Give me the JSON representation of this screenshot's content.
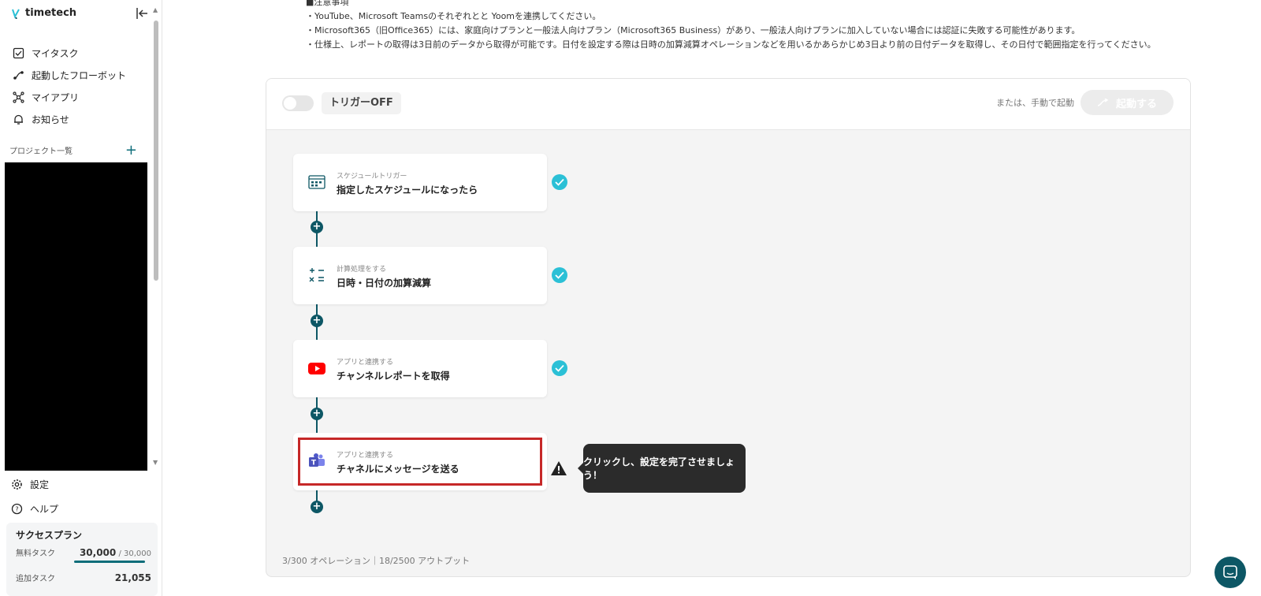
{
  "sidebar": {
    "brand": "timetech",
    "nav": [
      {
        "label": "マイタスク",
        "icon": "checkbox-icon"
      },
      {
        "label": "起動したフローボット",
        "icon": "flowbot-icon"
      },
      {
        "label": "マイアプリ",
        "icon": "apps-icon"
      },
      {
        "label": "お知らせ",
        "icon": "bell-icon"
      }
    ],
    "projects_heading": "プロジェクト一覧",
    "projects_add": "+",
    "bottom": [
      {
        "label": "設定",
        "icon": "gear-icon"
      },
      {
        "label": "ヘルプ",
        "icon": "help-icon"
      }
    ],
    "plan": {
      "title": "サクセスプラン",
      "free_label": "無料タスク",
      "free_used": "30,000",
      "free_total": "/ 30,000",
      "free_ratio": 1.0,
      "extra_label": "追加タスク",
      "extra_value": "21,055"
    }
  },
  "notes": {
    "heading": "■注意事項",
    "lines": [
      "・YouTube、Microsoft Teamsのそれぞれとと Yoomを連携してください。",
      "・Microsoft365（旧Office365）には、家庭向けプランと一般法人向けプラン（Microsoft365 Business）があり、一般法人向けプランに加入していない場合には認証に失敗する可能性があります。",
      "・仕様上、レポートの取得は3日前のデータから取得が可能です。日付を設定する際は日時の加算減算オペレーションなどを用いるかあらかじめ3日より前の日付データを取得し、その日付で範囲指定を行ってください。"
    ]
  },
  "flow": {
    "trigger_label": "トリガーOFF",
    "trigger_on": false,
    "manual_label": "または、手動で起動",
    "run_label": "起動する",
    "plus": "+",
    "steps": [
      {
        "sub": "スケジュールトリガー",
        "title": "指定したスケジュールになったら",
        "icon": "schedule-icon",
        "status": "done"
      },
      {
        "sub": "計算処理をする",
        "title": "日時・日付の加算減算",
        "icon": "calculator-icon",
        "status": "done"
      },
      {
        "sub": "アプリと連携する",
        "title": "チャンネルレポートを取得",
        "icon": "youtube-icon",
        "status": "done"
      },
      {
        "sub": "アプリと連携する",
        "title": "チャネルにメッセージを送る",
        "icon": "teams-icon",
        "status": "warning"
      }
    ],
    "tooltip": "クリックし、設定を完了させましょう！",
    "stats": "3/300 オペレーション｜18/2500 アウトプット"
  },
  "colors": {
    "accent": "#0d5765",
    "check": "#2bc0d6",
    "highlight": "#c62828"
  }
}
